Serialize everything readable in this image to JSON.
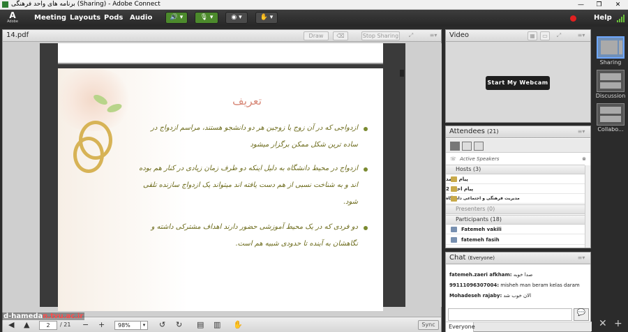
{
  "window": {
    "title": "برنامه های واحد فرهنگی (Sharing) - Adobe Connect",
    "btn_minimize": "—",
    "btn_restore": "❐",
    "btn_close": "✕"
  },
  "menubar": {
    "logo": "Adobe",
    "items": [
      "Meeting",
      "Layouts",
      "Pods",
      "Audio"
    ],
    "help": "Help",
    "colors": {
      "accent_green": "#4c8a2c",
      "record_red": "#e02020"
    }
  },
  "share_pod": {
    "title": "14.pdf",
    "draw": "Draw",
    "stop_sharing": "Stop Sharing",
    "slide_title": "تعریف",
    "bullets": [
      "ازدواجی که در آن زوج یا زوجین هر دو دانشجو هستند، مراسم ازدواج در ساده ترین شکل ممکن برگزار میشود",
      "ازدواج در محیط دانشگاه به دلیل اینکه دو طرف زمان زیادی در کنار هم بوده اند و به شناخت نسبی از هم دست یافته اند میتواند یک ازدواج سازنده تلقی شود.",
      "دو فردی که در یک محیط آموزشی حضور دارند اهداف مشترکی داشته و نگاهشان به آینده تا حدودی شبیه هم است."
    ],
    "page_current": "2",
    "page_total": "/ 21",
    "zoom": "98%",
    "sync": "Sync"
  },
  "watermark": {
    "prefix": "d-hameda",
    "highlight": "n.tvu.ac.ir"
  },
  "video_pod": {
    "title": "Video",
    "webcam_button": "Start My Webcam"
  },
  "attendees": {
    "title": "Attendees",
    "count": "(21)",
    "active_speakers": "Active Speakers",
    "hosts_group": "Hosts (3)",
    "hosts": [
      "پیام احمد",
      "پیام احمد 2",
      "مدیریت فرهنگی و اجتماعی دانشگاه"
    ],
    "presenters_group": "Presenters (0)",
    "participants_group": "Participants (18)",
    "participants": [
      "Fatemeh vakili",
      "fatemeh fasih"
    ]
  },
  "chat": {
    "title": "Chat",
    "scope": "(Everyone)",
    "messages": [
      {
        "sender": "fatemeh.zaeri afkham:",
        "text": "صدا خوبه"
      },
      {
        "sender": "99111096307004:",
        "text": "misheh man beram kelas daram"
      },
      {
        "sender": "Mohadeseh rajaby:",
        "text": "الان خوب شد"
      }
    ],
    "tab": "Everyone"
  },
  "layouts": {
    "items": [
      "Sharing",
      "Discussion",
      "Collabo..."
    ]
  }
}
